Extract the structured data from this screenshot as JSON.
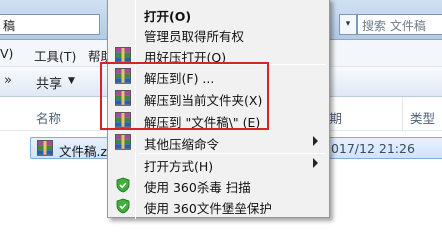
{
  "explorer": {
    "address_text": "稿",
    "address_dropdown_icon": "▾",
    "search_placeholder": "搜索 文件稿",
    "menu": [
      "V)",
      "工具(T)",
      "帮助"
    ],
    "toolbar": {
      "chevron": "»",
      "share_label": "共享",
      "share_arrow": "▼"
    },
    "columns": {
      "name": "名称",
      "modified": "修改日期",
      "type": "类型"
    },
    "file": {
      "name": "文件稿.zip",
      "modified": "2017/12 21:26",
      "type": ""
    }
  },
  "context_menu": {
    "items": [
      {
        "label": "打开(O)",
        "bold": true,
        "icon": "none",
        "submenu": false
      },
      {
        "label": "管理员取得所有权",
        "bold": false,
        "icon": "none",
        "submenu": false
      },
      {
        "label": "用好压打开(Q)",
        "bold": false,
        "icon": "archive-icon",
        "submenu": false
      },
      {
        "label": "解压到(F) ...",
        "bold": false,
        "icon": "archive-icon",
        "submenu": false
      },
      {
        "label": "解压到当前文件夹(X)",
        "bold": false,
        "icon": "archive-icon",
        "submenu": false
      },
      {
        "label": "解压到 \"文件稿\\\" (E)",
        "bold": false,
        "icon": "archive-icon",
        "submenu": false
      },
      {
        "label": "其他压缩命令",
        "bold": false,
        "icon": "archive-icon",
        "submenu": true
      },
      {
        "label": "打开方式(H)",
        "bold": false,
        "icon": "none",
        "submenu": true
      },
      {
        "label": "使用 360杀毒 扫描",
        "bold": false,
        "icon": "shield-icon",
        "submenu": false
      },
      {
        "label": "使用 360文件堡垒保护",
        "bold": false,
        "icon": "shield-icon",
        "submenu": false
      }
    ]
  },
  "colors": {
    "highlight_box": "#d42424",
    "selection": "#cfe3fb",
    "menu_background": "#f1f1f1"
  }
}
